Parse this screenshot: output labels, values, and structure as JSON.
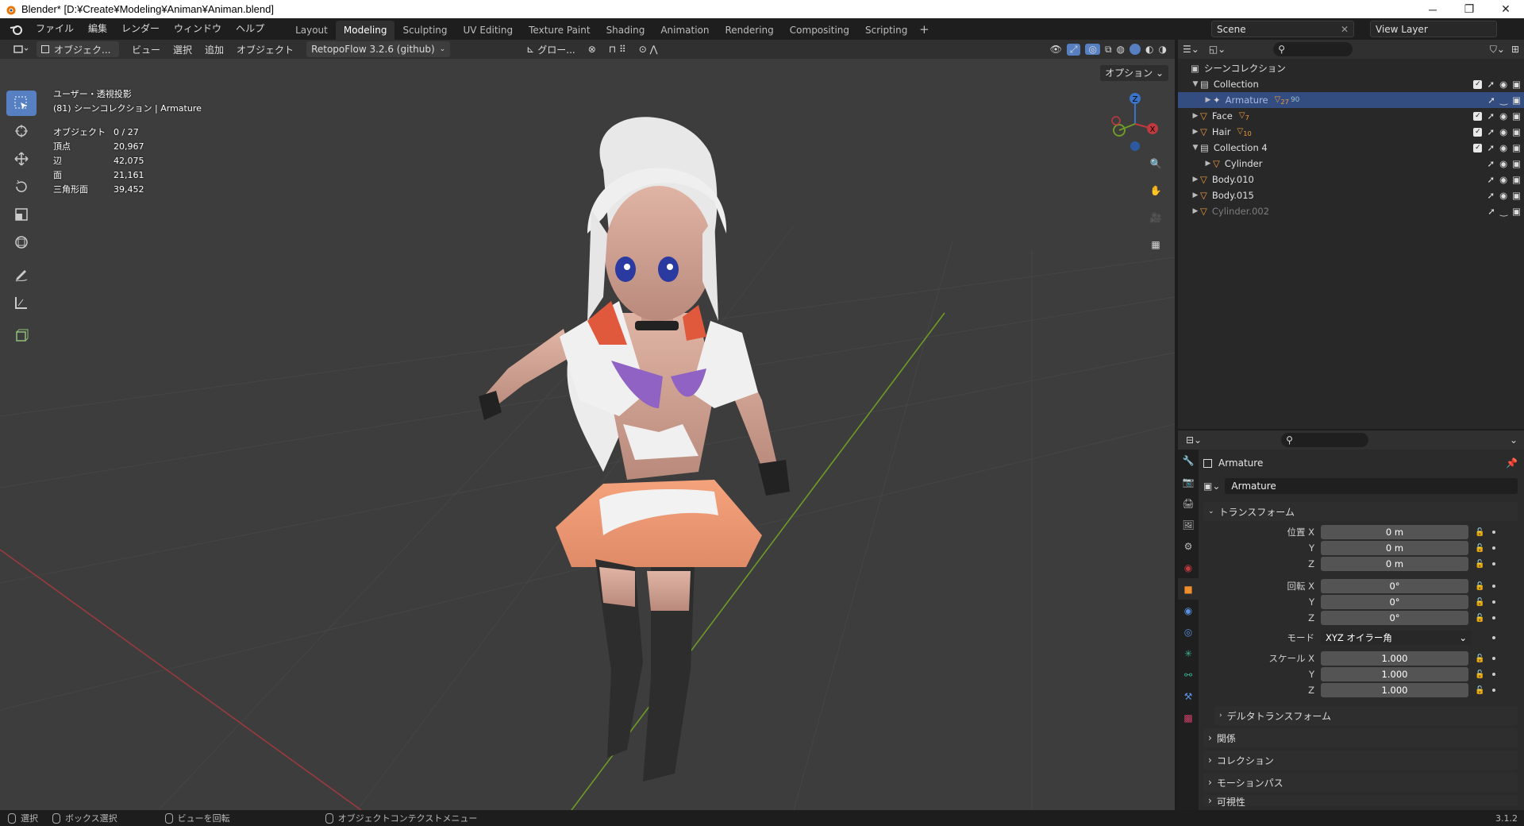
{
  "window": {
    "title": "Blender* [D:¥Create¥Modeling¥Animan¥Animan.blend]",
    "min": "─",
    "max": "❐",
    "close": "✕"
  },
  "menu": [
    "ファイル",
    "編集",
    "レンダー",
    "ウィンドウ",
    "ヘルプ"
  ],
  "workspaces": [
    {
      "label": "Layout",
      "active": false
    },
    {
      "label": "Modeling",
      "active": true
    },
    {
      "label": "Sculpting",
      "active": false
    },
    {
      "label": "UV Editing",
      "active": false
    },
    {
      "label": "Texture Paint",
      "active": false
    },
    {
      "label": "Shading",
      "active": false
    },
    {
      "label": "Animation",
      "active": false
    },
    {
      "label": "Rendering",
      "active": false
    },
    {
      "label": "Compositing",
      "active": false
    },
    {
      "label": "Scripting",
      "active": false
    }
  ],
  "scene": {
    "name": "Scene",
    "view_layer": "View Layer"
  },
  "viewport_header": {
    "mode": "オブジェク...",
    "menus": [
      "ビュー",
      "選択",
      "追加",
      "オブジェクト"
    ],
    "addon": "RetopoFlow 3.2.6 (github)",
    "orientation": "グロー..."
  },
  "viewport": {
    "view_name": "ユーザー・透視投影",
    "collection_line": "(81) シーンコレクション | Armature",
    "options": "オプション",
    "stats": [
      {
        "label": "オブジェクト",
        "value": "0 / 27"
      },
      {
        "label": "頂点",
        "value": "20,967"
      },
      {
        "label": "辺",
        "value": "42,075"
      },
      {
        "label": "面",
        "value": "21,161"
      },
      {
        "label": "三角形面",
        "value": "39,452"
      }
    ],
    "gizmo": {
      "z": "Z",
      "x": "X",
      "y": "Y"
    }
  },
  "outliner": {
    "root": "シーンコレクション",
    "rows": [
      {
        "label": "Collection",
        "indent": 1,
        "type": "collection",
        "expanded": true,
        "selected": false,
        "checkbox": true,
        "dim": false
      },
      {
        "label": "Armature",
        "indent": 2,
        "type": "armature",
        "expanded": false,
        "selected": true,
        "checkbox": false,
        "dim": false,
        "badge1": "27",
        "badge2": "90"
      },
      {
        "label": "Face",
        "indent": 1,
        "type": "mesh",
        "expanded": false,
        "selected": false,
        "checkbox": true,
        "dim": false,
        "badge1": "7"
      },
      {
        "label": "Hair",
        "indent": 1,
        "type": "mesh",
        "expanded": false,
        "selected": false,
        "checkbox": true,
        "dim": false,
        "badge1": "10"
      },
      {
        "label": "Collection 4",
        "indent": 1,
        "type": "collection",
        "expanded": true,
        "selected": false,
        "checkbox": true,
        "dim": false
      },
      {
        "label": "Cylinder",
        "indent": 2,
        "type": "mesh",
        "expanded": false,
        "selected": false,
        "checkbox": false,
        "dim": false
      },
      {
        "label": "Body.010",
        "indent": 1,
        "type": "mesh",
        "expanded": false,
        "selected": false,
        "checkbox": false,
        "dim": false
      },
      {
        "label": "Body.015",
        "indent": 1,
        "type": "mesh",
        "expanded": false,
        "selected": false,
        "checkbox": false,
        "dim": false
      },
      {
        "label": "Cylinder.002",
        "indent": 1,
        "type": "mesh",
        "expanded": false,
        "selected": false,
        "checkbox": false,
        "dim": true
      }
    ]
  },
  "properties": {
    "object_name": "Armature",
    "data_name": "Armature",
    "transform_panel": "トランスフォーム",
    "location": {
      "label": "位置 X",
      "x": "0 m",
      "y": "0 m",
      "z": "0 m"
    },
    "rotation": {
      "label": "回転 X",
      "x": "0°",
      "y": "0°",
      "z": "0°"
    },
    "mode": {
      "label": "モード",
      "value": "XYZ オイラー角"
    },
    "scale": {
      "label": "スケール X",
      "x": "1.000",
      "y": "1.000",
      "z": "1.000"
    },
    "axis_y": "Y",
    "axis_z": "Z",
    "delta": "デルタトランスフォーム",
    "panels": [
      "関係",
      "コレクション",
      "モーションパス",
      "可視性"
    ]
  },
  "statusbar": {
    "select": "選択",
    "box_select": "ボックス選択",
    "rotate_view": "ビューを回転",
    "context_menu": "オブジェクトコンテクストメニュー",
    "version": "3.1.2"
  },
  "colors": {
    "accent": "#5680c2",
    "selected_row": "#334d80",
    "x_axis": "#c0393e",
    "y_axis": "#6e9a26",
    "z_axis": "#3a74c9",
    "skirt": "#ef9a73"
  }
}
